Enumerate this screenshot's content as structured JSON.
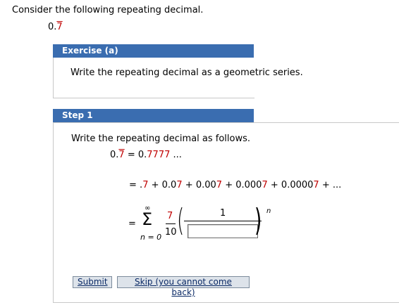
{
  "prompt": "Consider the following repeating decimal.",
  "repeating_decimal": {
    "whole": "0.",
    "repeat": "7"
  },
  "exercise": {
    "title": "Exercise (a)",
    "instruction": "Write the repeating decimal as a geometric series."
  },
  "step": {
    "title": "Step 1",
    "instruction": "Write the repeating decimal as follows.",
    "line1": {
      "lhs_whole": "0.",
      "lhs_repeat": "7",
      "eq": "=",
      "rhs_prefix": "0.",
      "rhs_red": "7777",
      "rhs_suffix": " ..."
    },
    "line2": {
      "eq": "=",
      "terms": [
        {
          "plain": ".",
          "red": "7"
        },
        {
          "plain": "0.0",
          "red": "7"
        },
        {
          "plain": "0.00",
          "red": "7"
        },
        {
          "plain": "0.000",
          "red": "7"
        },
        {
          "plain": "0.0000",
          "red": "7"
        }
      ],
      "plus": "+",
      "tail": "+ ..."
    },
    "sum": {
      "eq": "=",
      "upper": "∞",
      "sigma": "Σ",
      "lower": "n = 0",
      "coef_num": "7",
      "coef_den": "10",
      "inner_num": "1",
      "answer_value": "",
      "exponent": "n"
    }
  },
  "buttons": {
    "submit": "Submit",
    "skip": "Skip (you cannot come back)"
  },
  "colors": {
    "bar": "#3a6db0",
    "highlight": "#c00000"
  }
}
